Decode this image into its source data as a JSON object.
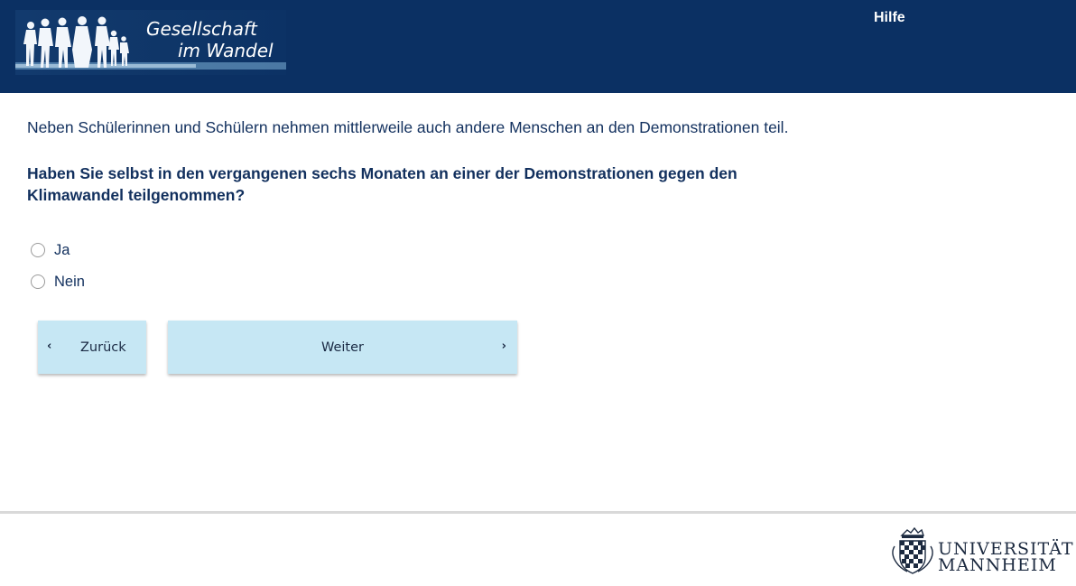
{
  "header": {
    "logo_line1": "Gesellschaft",
    "logo_line2": "im Wandel",
    "help_label": "Hilfe",
    "background_color": "#0b3063"
  },
  "survey": {
    "intro": "Neben Schülerinnen und Schülern nehmen mittlerweile auch andere Menschen an den Demonstrationen teil.",
    "question": "Haben Sie selbst in den vergangenen sechs Monaten an einer der Demonstrationen gegen den Klimawandel teilgenommen?",
    "options": [
      {
        "label": "Ja",
        "selected": false
      },
      {
        "label": "Nein",
        "selected": false
      }
    ]
  },
  "navigation": {
    "back_label": "Zurück",
    "next_label": "Weiter",
    "back_icon": "chevron-left-icon",
    "next_icon": "chevron-right-icon",
    "button_color": "#c6e7f4"
  },
  "footer": {
    "university_line1": "UNIVERSITÄT",
    "university_line2": "MANNHEIM"
  }
}
